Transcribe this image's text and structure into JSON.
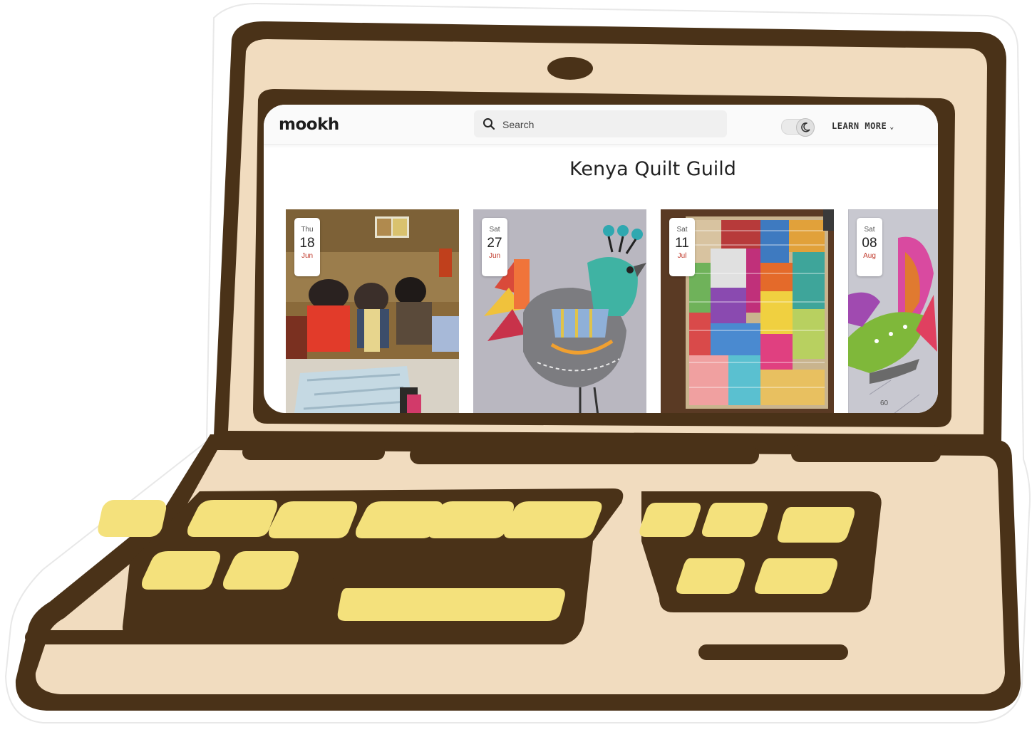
{
  "header": {
    "logo": "mookh",
    "search_placeholder": "Search",
    "learn_more_label": "LEARN MORE"
  },
  "page": {
    "title": "Kenya Quilt Guild"
  },
  "events": [
    {
      "weekday": "Thu",
      "day": "18",
      "month": "Jun"
    },
    {
      "weekday": "Sat",
      "day": "27",
      "month": "Jun"
    },
    {
      "weekday": "Sat",
      "day": "11",
      "month": "Jul"
    },
    {
      "weekday": "Sat",
      "day": "08",
      "month": "Aug"
    }
  ],
  "colors": {
    "laptop_body": "#f1dcbf",
    "laptop_outline": "#4a3218",
    "keys": "#f4e17c",
    "badge_month": "#c0392b"
  }
}
